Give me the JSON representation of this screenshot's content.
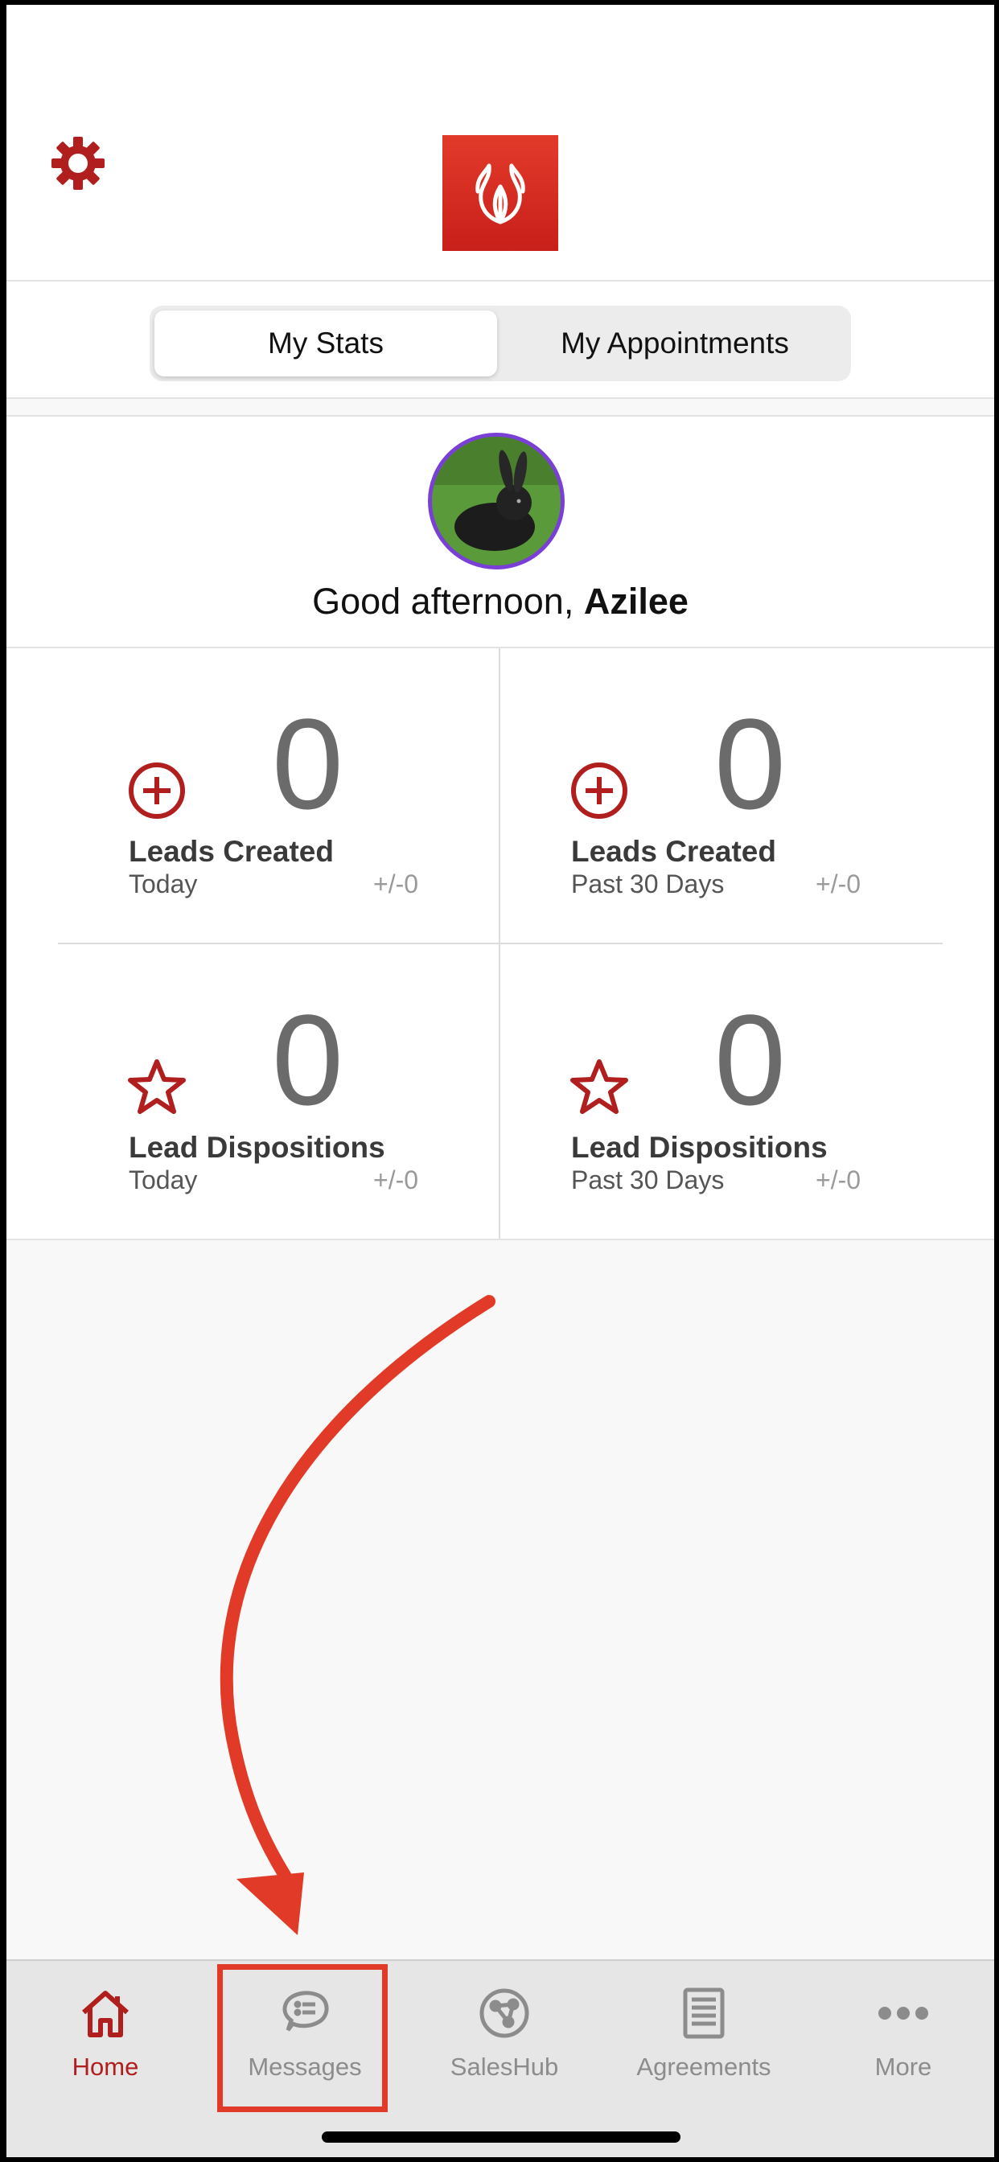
{
  "header": {
    "settings_icon": "gear-icon",
    "logo_icon": "brand-logo-icon",
    "brand_color": "#d62b1f"
  },
  "segments": {
    "stats_label": "My Stats",
    "appointments_label": "My Appointments",
    "selected": "My Stats"
  },
  "profile": {
    "greeting_prefix": "Good afternoon, ",
    "user_name": "Azilee",
    "avatar_ring_color": "#7a3fd6"
  },
  "stats": [
    {
      "icon": "plus-circle-icon",
      "value": "0",
      "title": "Leads Created",
      "period": "Today",
      "delta": "+/-0"
    },
    {
      "icon": "plus-circle-icon",
      "value": "0",
      "title": "Leads Created",
      "period": "Past 30 Days",
      "delta": "+/-0"
    },
    {
      "icon": "star-icon",
      "value": "0",
      "title": "Lead Dispositions",
      "period": "Today",
      "delta": "+/-0"
    },
    {
      "icon": "star-icon",
      "value": "0",
      "title": "Lead Dispositions",
      "period": "Past 30 Days",
      "delta": "+/-0"
    }
  ],
  "tabs": [
    {
      "label": "Home",
      "icon": "home-icon",
      "active": true
    },
    {
      "label": "Messages",
      "icon": "chat-bubble-icon",
      "active": false
    },
    {
      "label": "SalesHub",
      "icon": "globe-network-icon",
      "active": false
    },
    {
      "label": "Agreements",
      "icon": "document-list-icon",
      "active": false
    },
    {
      "label": "More",
      "icon": "more-dots-icon",
      "active": false
    }
  ],
  "annotation": {
    "arrow_color": "#e23a28",
    "highlighted_tab": "Messages"
  }
}
